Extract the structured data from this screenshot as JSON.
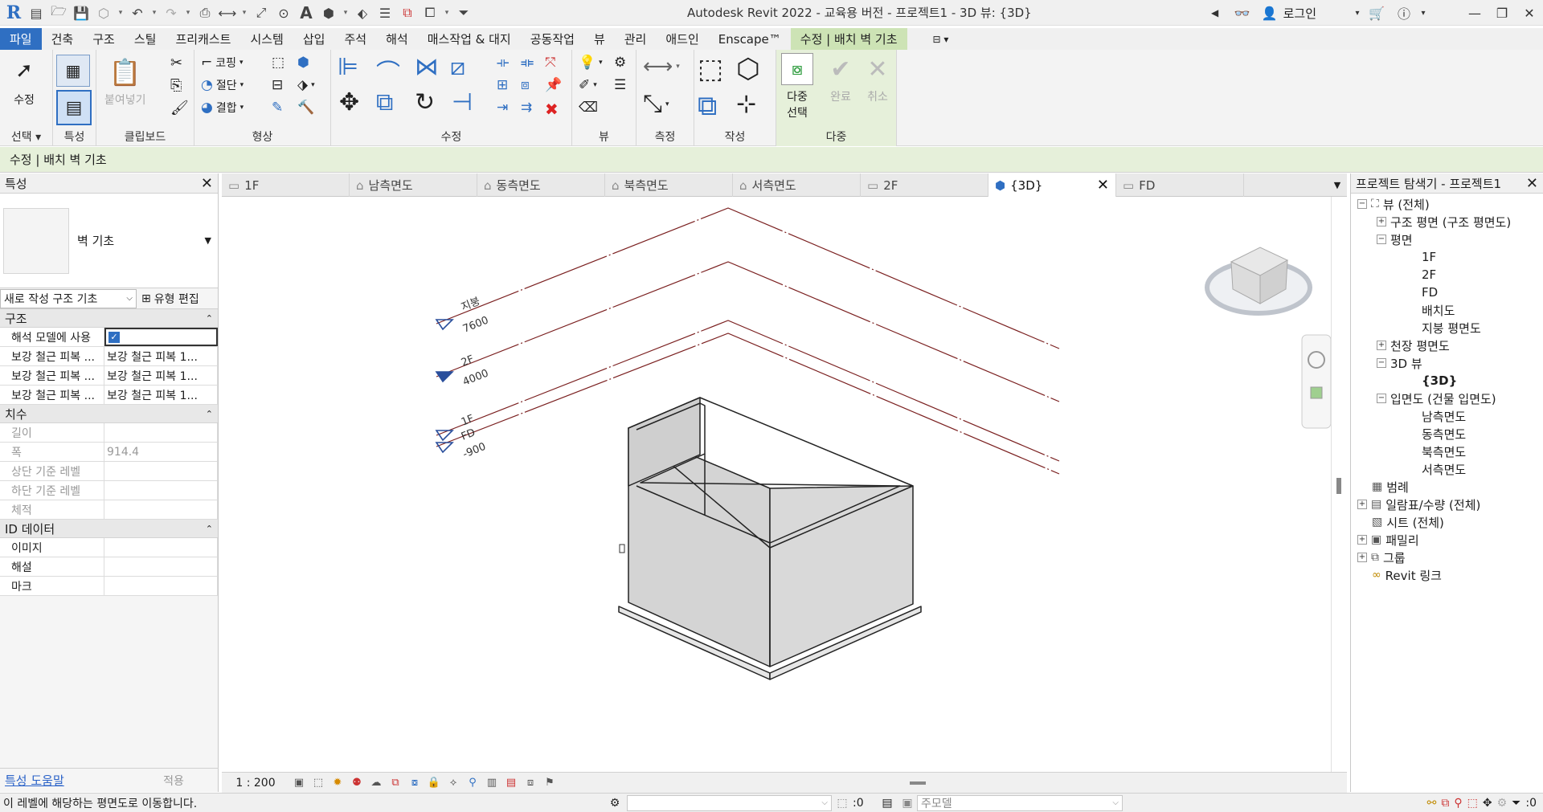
{
  "app": {
    "title": "Autodesk Revit 2022 - 교육용 버전 - 프로젝트1 - 3D 뷰: {3D}",
    "login": "로그인",
    "accent": "#2f6fc2",
    "context_green": "#e6f0da"
  },
  "menu_tabs": [
    "파일",
    "건축",
    "구조",
    "스틸",
    "프리캐스트",
    "시스템",
    "삽입",
    "주석",
    "해석",
    "매스작업 & 대지",
    "공동작업",
    "뷰",
    "관리",
    "애드인",
    "Enscape™",
    "수정 | 배치 벽 기초"
  ],
  "ribbon": {
    "select": {
      "modify": "수정",
      "label": "선택"
    },
    "properties": {
      "label": "특성"
    },
    "clipboard": {
      "paste": "붙여넣기",
      "label": "클립보드"
    },
    "geometry": {
      "cope": "코핑",
      "cut": "절단",
      "join": "결합",
      "label": "형상"
    },
    "modify": {
      "label": "수정"
    },
    "view": {
      "label": "뷰"
    },
    "measure": {
      "label": "측정"
    },
    "create": {
      "label": "작성"
    },
    "multiple": {
      "multi_select_1": "다중",
      "multi_select_2": "선택",
      "finish": "완료",
      "cancel": "취소",
      "label": "다중"
    }
  },
  "options_bar": {
    "text": "수정 | 배치 벽 기초"
  },
  "properties": {
    "title": "특성",
    "type_name": "벽 기초",
    "instance_selector": "새로 작성 구조 기초",
    "edit_type": "유형 편집",
    "sections": [
      {
        "name": "구조",
        "rows": [
          {
            "key": "해석 모델에 사용",
            "value": "",
            "checkbox": true
          },
          {
            "key": "보강 철근 피복 ...",
            "value": "보강 철근 피복 1..."
          },
          {
            "key": "보강 철근 피복 ...",
            "value": "보강 철근 피복 1..."
          },
          {
            "key": "보강 철근 피복 ...",
            "value": "보강 철근 피복 1..."
          }
        ]
      },
      {
        "name": "치수",
        "rows": [
          {
            "key": "길이",
            "value": ""
          },
          {
            "key": "폭",
            "value": "914.4"
          },
          {
            "key": "상단 기준 레벨",
            "value": ""
          },
          {
            "key": "하단 기준 레벨",
            "value": ""
          },
          {
            "key": "체적",
            "value": ""
          }
        ]
      },
      {
        "name": "ID 데이터",
        "rows": [
          {
            "key": "이미지",
            "value": ""
          },
          {
            "key": "해설",
            "value": ""
          },
          {
            "key": "마크",
            "value": ""
          }
        ]
      }
    ],
    "help_link": "특성 도움말",
    "apply": "적용"
  },
  "view_tabs": [
    "1F",
    "남측면도",
    "동측면도",
    "북측면도",
    "서측면도",
    "2F",
    "{3D}",
    "FD"
  ],
  "levels": [
    {
      "name": "지붕",
      "elevation": "7600"
    },
    {
      "name": "2F",
      "elevation": "4000"
    },
    {
      "name": "1F",
      "elevation": ""
    },
    {
      "name": "FD",
      "elevation": "-900"
    }
  ],
  "view_bar": {
    "scale": "1 : 200"
  },
  "browser": {
    "title": "프로젝트 탐색기 - 프로젝트1",
    "nodes": [
      "뷰 (전체)",
      "구조 평면 (구조 평면도)",
      "평면",
      "1F",
      "2F",
      "FD",
      "배치도",
      "지붕 평면도",
      "천장 평면도",
      "3D 뷰",
      "{3D}",
      "입면도 (건물 입면도)",
      "남측면도",
      "동측면도",
      "북측면도",
      "서측면도",
      "범례",
      "일람표/수량 (전체)",
      "시트 (전체)",
      "패밀리",
      "그룹",
      "Revit 링크"
    ]
  },
  "status": {
    "message": "이 레벨에 해당하는 평면도로 이동합니다.",
    "workset_value": ":0",
    "model": "주모델",
    "filter_count": ":0"
  }
}
